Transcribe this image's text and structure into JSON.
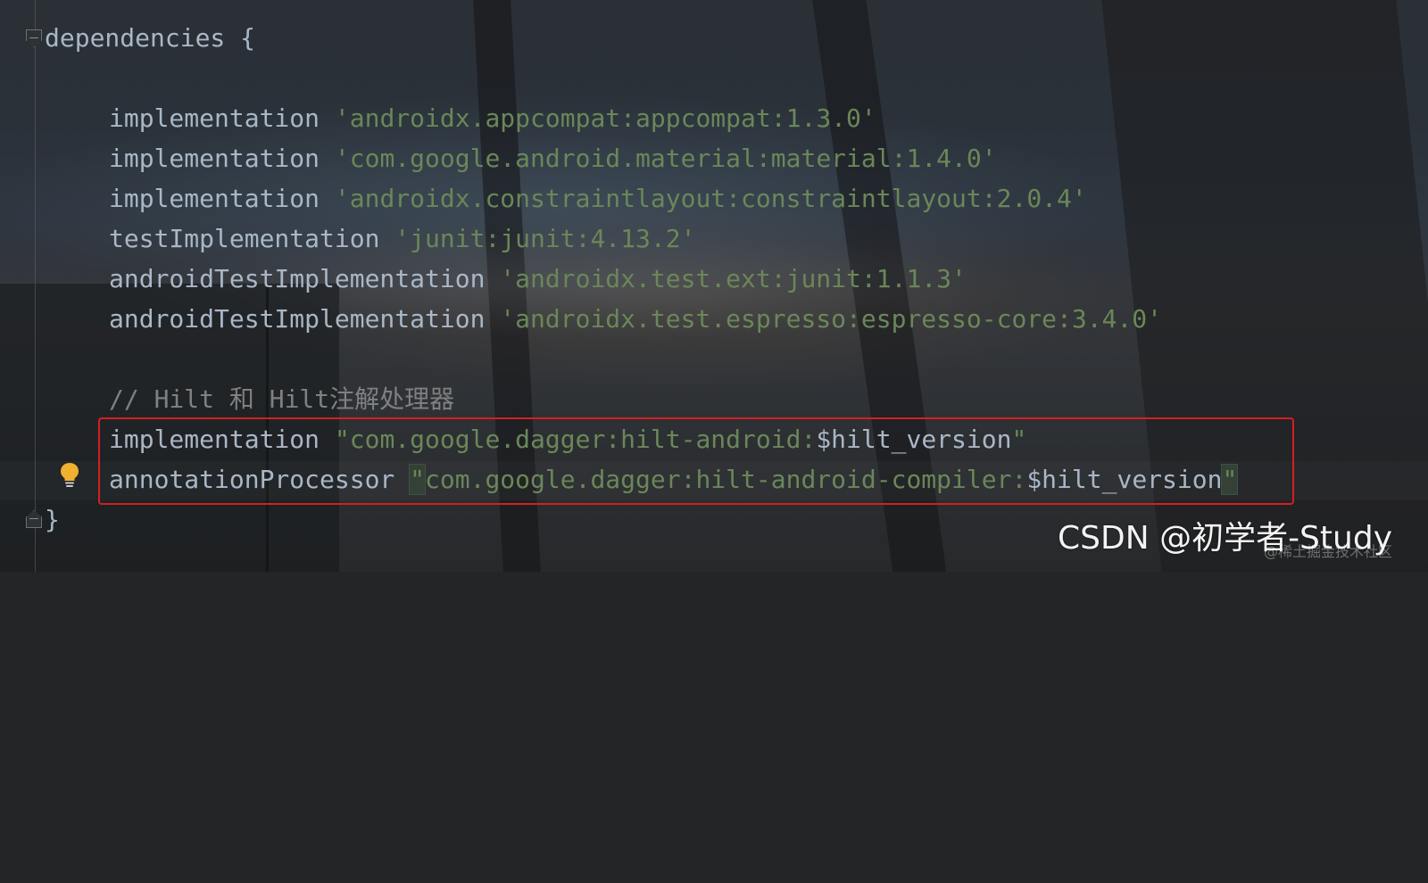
{
  "editor": {
    "lines": {
      "l1": {
        "keyword": "dependencies",
        "brace": " {"
      },
      "l2": {
        "keyword": "implementation",
        "string": "'androidx.appcompat:appcompat:1.3.0'"
      },
      "l3": {
        "keyword": "implementation",
        "string": "'com.google.android.material:material:1.4.0'"
      },
      "l4": {
        "keyword": "implementation",
        "string": "'androidx.constraintlayout:constraintlayout:2.0.4'"
      },
      "l5": {
        "keyword": "testImplementation",
        "string": "'junit:junit:4.13.2'"
      },
      "l6": {
        "keyword": "androidTestImplementation",
        "string": "'androidx.test.ext:junit:1.1.3'"
      },
      "l7": {
        "keyword": "androidTestImplementation",
        "string": "'androidx.test.espresso:espresso-core:3.4.0'"
      },
      "l8": {
        "comment": "// Hilt 和 Hilt注解处理器"
      },
      "l9": {
        "keyword": "implementation",
        "string_open": "\"com.google.dagger:hilt-android:",
        "variable": "$hilt_version",
        "string_close": "\""
      },
      "l10": {
        "keyword": "annotationProcessor",
        "quote_open": "\"",
        "string_open": "com.google.dagger:hilt-android-compiler:",
        "variable": "$hilt_version",
        "quote_close": "\""
      },
      "l11": {
        "brace": "}"
      }
    },
    "intention_icon": "lightbulb-icon",
    "annotation_color": "#d32020"
  },
  "watermark": {
    "text": "CSDN @初学者-Study",
    "sub": "@稀土掘金技术社区"
  }
}
